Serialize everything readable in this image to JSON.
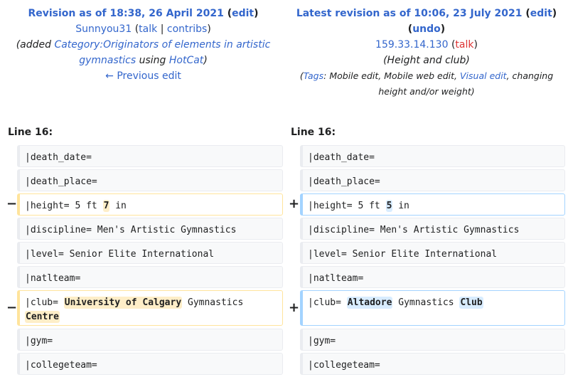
{
  "left_header": {
    "revision_prefix": "Revision as of 18:38, 26 April 2021",
    "edit_label": "edit",
    "user": "Sunnyou31",
    "talk_label": "talk",
    "separator": "|",
    "contribs_label": "contribs",
    "summary_prefix": "(added ",
    "summary_link": "Category:Originators of elements in artistic gymnastics",
    "summary_mid": " using ",
    "summary_tool": "HotCat",
    "summary_suffix": ")",
    "prev_edit_label": "← Previous edit"
  },
  "right_header": {
    "revision_prefix": "Latest revision as of 10:06, 23 July 2021",
    "edit_label": "edit",
    "undo_label": "undo",
    "ip": "159.33.14.130",
    "talk_label": "talk",
    "summary": "(Height and club)",
    "tags_open": "(",
    "tags_label": "Tags",
    "tags_text": ": Mobile edit, Mobile web edit, ",
    "tags_visual": "Visual edit",
    "tags_rest": ", changing height and/or weight)"
  },
  "line_label": "Line 16:",
  "markers": {
    "removed": "−",
    "added": "+"
  },
  "rows": {
    "death_date": "|death_date=",
    "death_place": "|death_place=",
    "height_pre": "|height= 5 ft ",
    "height_old": "7",
    "height_new": "5",
    "height_post": " in",
    "discipline": "|discipline= Men's Artistic Gymnastics",
    "level": "|level= Senior Elite International",
    "natlteam": "|natlteam=",
    "club_pre": "|club= ",
    "club_old_1": "University of Calgary",
    "club_mid": " Gymnastics ",
    "club_old_2": "Centre",
    "club_new_1": "Altadore",
    "club_new_2": "Club",
    "gym": "|gym=",
    "collegeteam": "|collegeteam="
  }
}
